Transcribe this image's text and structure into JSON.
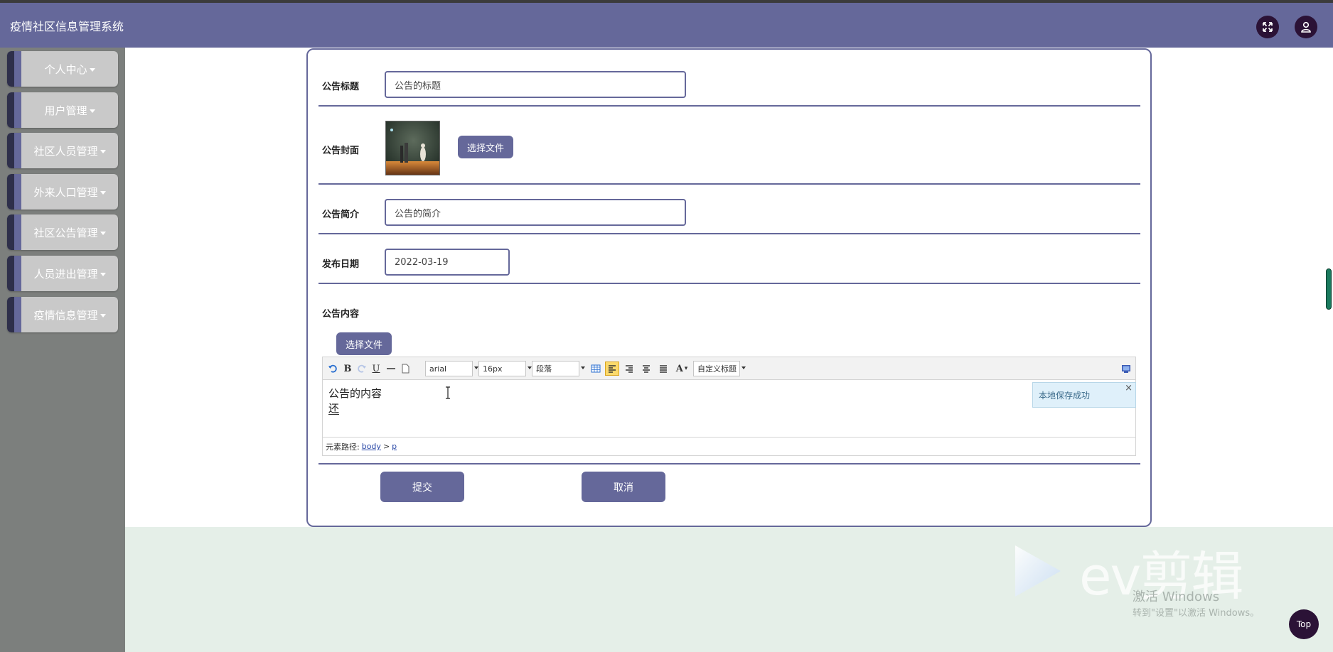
{
  "app": {
    "title": "疫情社区信息管理系统"
  },
  "header": {
    "fullscreen_icon": "expand-icon",
    "user_icon": "user-icon"
  },
  "sidebar": {
    "items": [
      {
        "label": "个人中心"
      },
      {
        "label": "用户管理"
      },
      {
        "label": "社区人员管理"
      },
      {
        "label": "外来人口管理"
      },
      {
        "label": "社区公告管理"
      },
      {
        "label": "人员进出管理"
      },
      {
        "label": "疫情信息管理"
      }
    ]
  },
  "form": {
    "title_label": "公告标题",
    "title_value": "公告的标题",
    "cover_label": "公告封面",
    "cover_button": "选择文件",
    "intro_label": "公告简介",
    "intro_value": "公告的简介",
    "date_label": "发布日期",
    "date_value": "2022-03-19",
    "content_label": "公告内容",
    "content_file_button": "选择文件",
    "submit_label": "提交",
    "cancel_label": "取消"
  },
  "editor": {
    "font_family": "arial",
    "font_size": "16px",
    "paragraph": "段落",
    "custom_title": "自定义标题",
    "content_line1": "公告的内容",
    "content_line2": "还",
    "toast_text": "本地保存成功",
    "toast_close": "×",
    "path_label": "元素路径:",
    "path_body": "body",
    "path_sep": ">",
    "path_p": "p"
  },
  "watermark": {
    "brand": "ev剪辑",
    "activate_title": "激活 Windows",
    "activate_hint": "转到\"设置\"以激活 Windows。"
  },
  "top_button": "Top",
  "colors": {
    "accent": "#65689a",
    "dark": "#2b1236",
    "sidebar_bg": "#7c7f7d",
    "page_bg": "#e5efe8"
  }
}
